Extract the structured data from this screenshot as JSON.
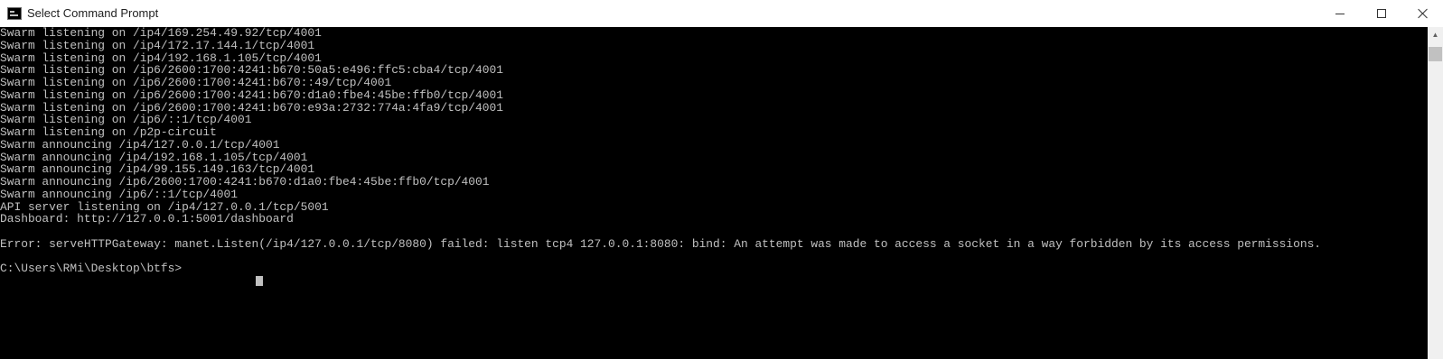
{
  "window": {
    "title": "Select Command Prompt",
    "icon": "cmd-icon"
  },
  "console": {
    "lines": [
      "Swarm listening on /ip4/169.254.49.92/tcp/4001",
      "Swarm listening on /ip4/172.17.144.1/tcp/4001",
      "Swarm listening on /ip4/192.168.1.105/tcp/4001",
      "Swarm listening on /ip6/2600:1700:4241:b670:50a5:e496:ffc5:cba4/tcp/4001",
      "Swarm listening on /ip6/2600:1700:4241:b670::49/tcp/4001",
      "Swarm listening on /ip6/2600:1700:4241:b670:d1a0:fbe4:45be:ffb0/tcp/4001",
      "Swarm listening on /ip6/2600:1700:4241:b670:e93a:2732:774a:4fa9/tcp/4001",
      "Swarm listening on /ip6/::1/tcp/4001",
      "Swarm listening on /p2p-circuit",
      "Swarm announcing /ip4/127.0.0.1/tcp/4001",
      "Swarm announcing /ip4/192.168.1.105/tcp/4001",
      "Swarm announcing /ip4/99.155.149.163/tcp/4001",
      "Swarm announcing /ip6/2600:1700:4241:b670:d1a0:fbe4:45be:ffb0/tcp/4001",
      "Swarm announcing /ip6/::1/tcp/4001",
      "API server listening on /ip4/127.0.0.1/tcp/5001",
      "Dashboard: http://127.0.0.1:5001/dashboard",
      "",
      "Error: serveHTTPGateway: manet.Listen(/ip4/127.0.0.1/tcp/8080) failed: listen tcp4 127.0.0.1:8080: bind: An attempt was made to access a socket in a way forbidden by its access permissions.",
      "",
      "C:\\Users\\RMi\\Desktop\\btfs>"
    ]
  },
  "colors": {
    "console_bg": "#000000",
    "console_fg": "#c0c0c0",
    "titlebar_bg": "#ffffff"
  },
  "icons": {
    "minimize": "minimize-icon",
    "maximize": "maximize-icon",
    "close": "close-icon",
    "scroll_up": "scroll-up-arrow-icon"
  }
}
